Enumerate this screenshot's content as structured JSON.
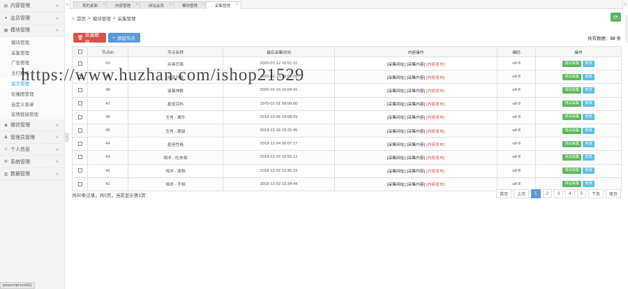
{
  "sidebar": {
    "menus": [
      {
        "label": "内容管理",
        "icon": "document-icon",
        "expanded": false
      },
      {
        "label": "会员管理",
        "icon": "user-icon",
        "expanded": false
      },
      {
        "label": "模块管理",
        "icon": "module-icon",
        "expanded": true,
        "children": [
          "模块管理",
          "采集管理",
          "广告管理",
          "主打模块",
          "留言管理",
          "轮播图管理",
          "自定义表单",
          "友情链接管理"
        ],
        "active_child": 4
      },
      {
        "label": "微信管理",
        "icon": "wechat-icon",
        "expanded": false
      },
      {
        "label": "管理员管理",
        "icon": "admin-icon",
        "expanded": false
      },
      {
        "label": "个人信息",
        "icon": "person-icon",
        "expanded": false
      },
      {
        "label": "系统管理",
        "icon": "gear-icon",
        "expanded": false
      },
      {
        "label": "数据管理",
        "icon": "database-icon",
        "expanded": false
      }
    ],
    "status_text": "javascript:void(0)"
  },
  "tabs": [
    {
      "label": "我的桌面",
      "active": false
    },
    {
      "label": "内容管理",
      "active": false
    },
    {
      "label": "网站会员",
      "active": false
    },
    {
      "label": "模块管理",
      "active": false
    },
    {
      "label": "采集管理",
      "active": true
    }
  ],
  "breadcrumb": [
    "首页",
    "模块管理",
    "采集管理"
  ],
  "toolbar": {
    "batch_delete": "批量删除",
    "add_node": "添加节点",
    "total_label": "共有数据：",
    "total_count": "50",
    "total_unit": " 条"
  },
  "table": {
    "headers": [
      "",
      "节点ID",
      "节点名称",
      "最后采集时间",
      "内容操作",
      "编码",
      "操作"
    ],
    "op_links": [
      "[采集网址]",
      "[采集内容]",
      "[内容发布]"
    ],
    "actions": [
      "测试采集",
      "修改"
    ],
    "rows": [
      {
        "id": "50",
        "name": "另画页面",
        "time": "2020-07-12 10:51:10",
        "enc": "utf-8"
      },
      {
        "id": "49",
        "name": "纯享列表",
        "time": "2020-02-16 16:51:09",
        "enc": "utf-8"
      },
      {
        "id": "48",
        "name": "诸葛神数",
        "time": "2020-02-16 16:04:41",
        "enc": "utf-8"
      },
      {
        "id": "47",
        "name": "星座百科",
        "time": "1970-01-01 08:00:00",
        "enc": "utf-8"
      },
      {
        "id": "46",
        "name": "生肖 - 属牛",
        "time": "2018-12-06 19:08:29",
        "enc": "utf-8"
      },
      {
        "id": "45",
        "name": "生肖 - 属鼠",
        "time": "2018-12-16 23:31:45",
        "enc": "utf-8"
      },
      {
        "id": "44",
        "name": "星座性格",
        "time": "2018-12-04 00:07:17",
        "enc": "utf-8"
      },
      {
        "id": "43",
        "name": "相术 - 旺夫相",
        "time": "2018-12-02 22:56:12",
        "enc": "utf-8"
      },
      {
        "id": "42",
        "name": "相术 - 面相",
        "time": "2018-12-02 22:45:19",
        "enc": "utf-8"
      },
      {
        "id": "41",
        "name": "相术 - 手相",
        "time": "2018-12-02 22:34:44",
        "enc": "utf-8"
      }
    ]
  },
  "footer": {
    "info": "共50条记录，共5页，当前显示第1页"
  },
  "pager": {
    "first": "首页",
    "prev": "上页",
    "pages": [
      "1",
      "2",
      "3",
      "4",
      "5"
    ],
    "current": "1",
    "next": "下页",
    "last": "尾页"
  },
  "watermark": "https://www.huzhan.com/ishop21529",
  "colors": {
    "danger": "#d9534f",
    "primary": "#5b9bd5",
    "success": "#5cb85c",
    "info": "#5bc0de",
    "link_active": "#1e9fff"
  }
}
